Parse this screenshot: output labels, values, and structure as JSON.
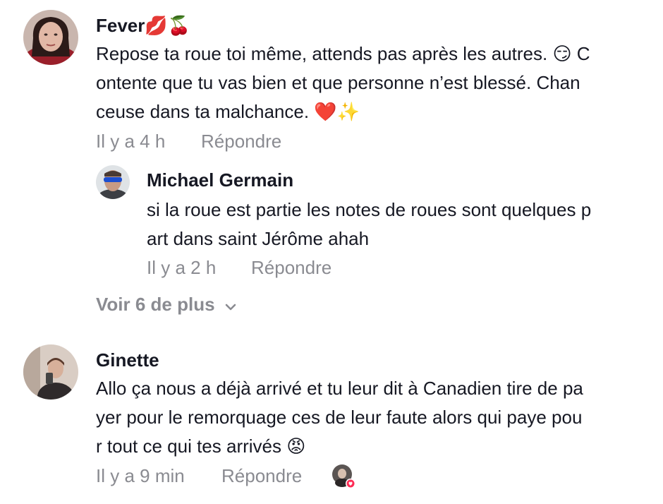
{
  "comments": [
    {
      "author": "Fever",
      "author_emojis": "💋🍒",
      "lines": [
        "Repose ta roue toi même, attends pas après les autres. 😏 C",
        "ontente que tu vas bien et que personne n’est blessé. Chan",
        "ceuse dans ta malchance. ❤️✨"
      ],
      "time": "Il y a 4 h",
      "reply_label": "Répondre"
    },
    {
      "author": "Ginette",
      "lines": [
        "Allo ça nous a déjà arrivé et tu leur dit à Canadien tire de pa",
        "yer pour le remorquage ces de leur faute alors qui paye pou",
        "r tout ce qui tes arrivés 😡"
      ],
      "time": "Il y a 9 min",
      "reply_label": "Répondre"
    }
  ],
  "reply": {
    "author": "Michael Germain",
    "lines": [
      "si la roue est partie les notes de roues sont quelques p",
      "art dans saint Jérôme ahah"
    ],
    "time": "Il y a 2 h",
    "reply_label": "Répondre"
  },
  "view_more": {
    "label": "Voir 6 de plus",
    "icon": "chevron-down-icon"
  },
  "colors": {
    "text": "#161823",
    "muted": "#8a8b91",
    "like_badge": "#fe2c55"
  }
}
